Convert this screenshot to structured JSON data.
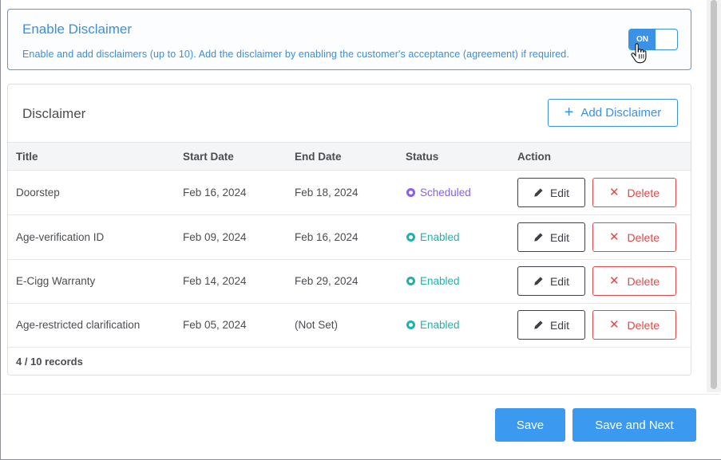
{
  "enable_section": {
    "title": "Enable Disclaimer",
    "description": "Enable and add disclaimers (up to 10). Add the disclaimer by enabling the customer's acceptance (agreement) if required.",
    "toggle_label": "ON",
    "toggle_state": "on"
  },
  "disclaimer_panel": {
    "title": "Disclaimer",
    "add_button_label": "Add Disclaimer",
    "columns": [
      "Title",
      "Start Date",
      "End Date",
      "Status",
      "Action"
    ],
    "rows": [
      {
        "title": "Doorstep",
        "start_date": "Feb 16, 2024",
        "end_date": "Feb 18, 2024",
        "status": "Scheduled",
        "edit_label": "Edit",
        "delete_label": "Delete"
      },
      {
        "title": "Age-verification ID",
        "start_date": "Feb 09, 2024",
        "end_date": "Feb 16, 2024",
        "status": "Enabled",
        "edit_label": "Edit",
        "delete_label": "Delete"
      },
      {
        "title": "E-Cigg Warranty",
        "start_date": "Feb 14, 2024",
        "end_date": "Feb 29, 2024",
        "status": "Enabled",
        "edit_label": "Edit",
        "delete_label": "Delete"
      },
      {
        "title": "Age-restricted clarification",
        "start_date": "Feb 05, 2024",
        "end_date": "(Not Set)",
        "status": "Enabled",
        "edit_label": "Edit",
        "delete_label": "Delete"
      }
    ],
    "records_text": "4 / 10 records"
  },
  "footer": {
    "save_label": "Save",
    "save_next_label": "Save and Next"
  },
  "colors": {
    "primary": "#3b91e6",
    "danger": "#e04848",
    "scheduled": "#8b5cf6",
    "enabled": "#20b2aa"
  },
  "icons": {
    "toggle_cursor": "hand-pointer-icon",
    "add": "plus-icon",
    "edit": "pencil-icon",
    "delete": "x-icon",
    "status": "status-dot-icon"
  }
}
